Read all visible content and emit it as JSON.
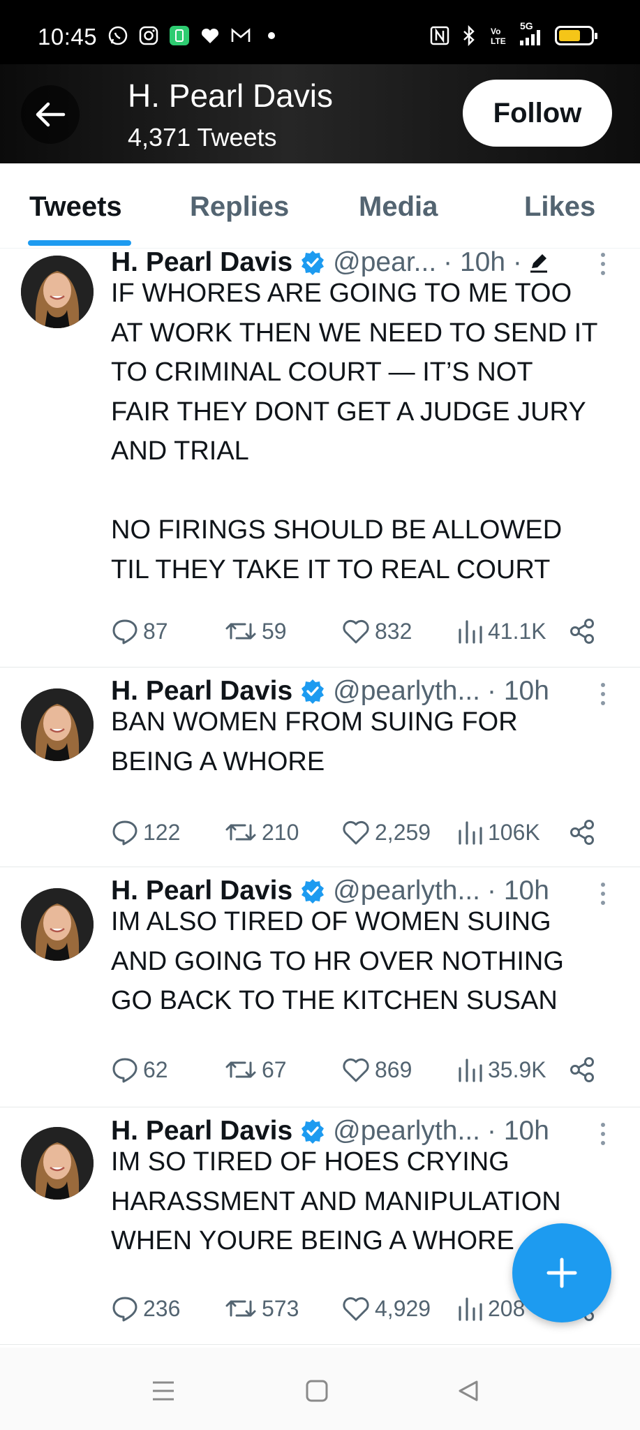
{
  "status_bar": {
    "time": "10:45",
    "network": "5G",
    "battery_level": 0.6,
    "left_icons": [
      "whatsapp-icon",
      "instagram-icon",
      "app-badge-icon",
      "heart-icon",
      "gmail-icon",
      "dot-icon"
    ],
    "right_icons": [
      "nfc-icon",
      "bluetooth-icon",
      "volte-icon",
      "signal-icon",
      "battery-icon"
    ],
    "colors": {
      "battery_fill": "#f5c518",
      "badge": "#2ecc71"
    }
  },
  "header": {
    "name": "H. Pearl Davis",
    "tweet_count": "4,371 Tweets",
    "follow_label": "Follow"
  },
  "tabs": [
    {
      "label": "Tweets",
      "active": true
    },
    {
      "label": "Replies",
      "active": false
    },
    {
      "label": "Media",
      "active": false
    },
    {
      "label": "Likes",
      "active": false
    }
  ],
  "tweets": [
    {
      "name": "H. Pearl Davis",
      "handle": "@pear...",
      "time": "· 10h ·",
      "edited": true,
      "body": "IF WHORES ARE GOING TO ME TOO\nAT WORK THEN WE NEED TO SEND IT\nTO CRIMINAL COURT — IT’S NOT\nFAIR THEY DONT GET A JUDGE JURY\nAND TRIAL\n\nNO FIRINGS SHOULD BE ALLOWED\nTIL THEY TAKE IT TO REAL COURT",
      "replies": "87",
      "retweets": "59",
      "likes": "832",
      "views": "41.1K"
    },
    {
      "name": "H. Pearl Davis",
      "handle": "@pearlyth...",
      "time": "· 10h",
      "edited": false,
      "body": "BAN WOMEN FROM SUING FOR\nBEING A WHORE",
      "replies": "122",
      "retweets": "210",
      "likes": "2,259",
      "views": "106K"
    },
    {
      "name": "H. Pearl Davis",
      "handle": "@pearlyth...",
      "time": "· 10h",
      "edited": false,
      "body": "IM ALSO TIRED OF WOMEN SUING\nAND GOING TO HR OVER NOTHING\nGO BACK TO THE KITCHEN SUSAN",
      "replies": "62",
      "retweets": "67",
      "likes": "869",
      "views": "35.9K"
    },
    {
      "name": "H. Pearl Davis",
      "handle": "@pearlyth...",
      "time": "· 10h",
      "edited": false,
      "body": "IM SO TIRED OF HOES CRYING\nHARASSMENT AND MANIPULATION\nWHEN YOURE BEING A WHORE",
      "replies": "236",
      "retweets": "573",
      "likes": "4,929",
      "views": "208"
    }
  ],
  "fab_icon": "plus-icon",
  "nav": [
    "menu-icon",
    "home-square-icon",
    "back-triangle-icon"
  ],
  "colors": {
    "accent": "#1d9bf0",
    "text": "#0f1419",
    "muted": "#536471"
  }
}
